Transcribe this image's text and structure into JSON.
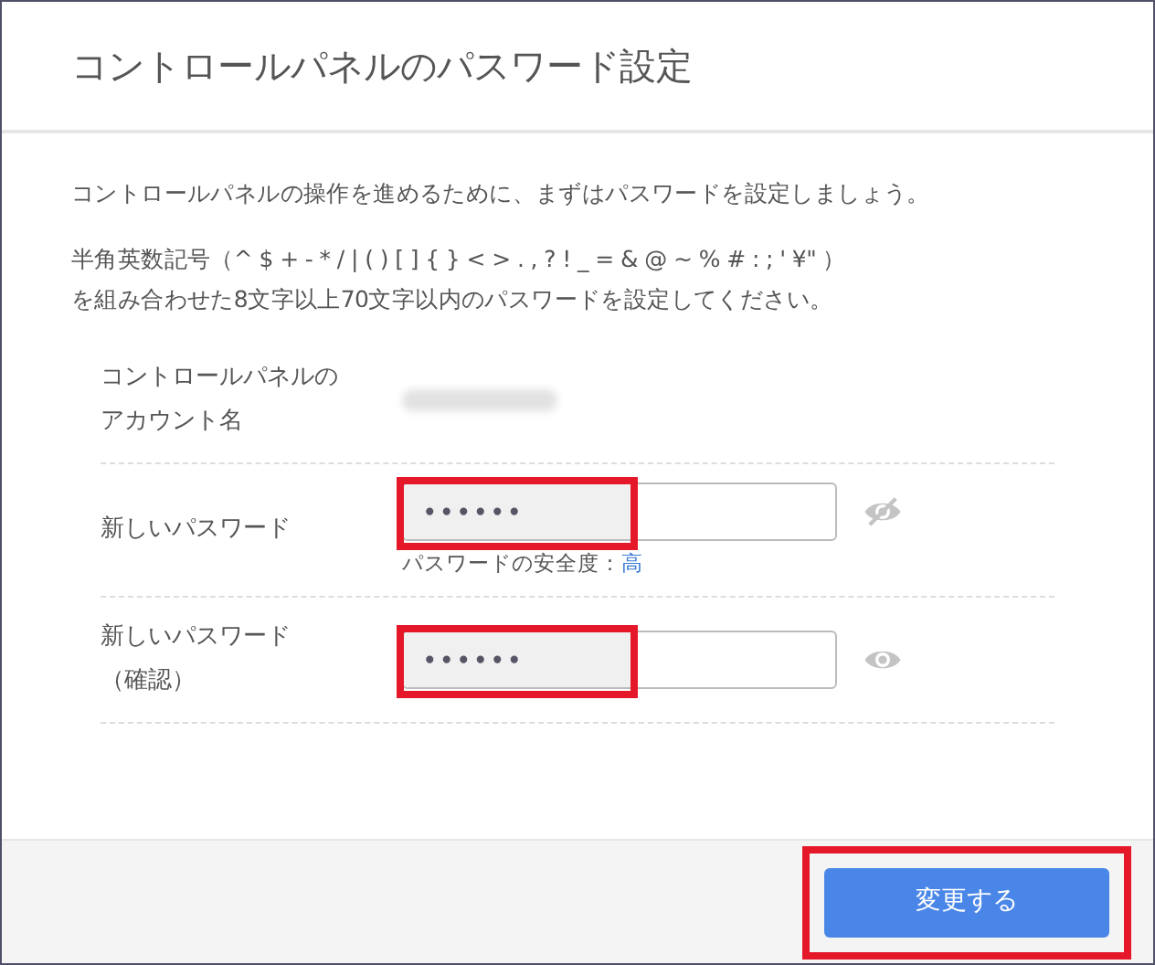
{
  "dialog": {
    "title": "コントロールパネルのパスワード設定"
  },
  "intro": "コントロールパネルの操作を進めるために、まずはパスワードを設定しましょう。",
  "rules": [
    "半角英数記号（^ $ + - * / | ( ) [ ] { } < > . , ? ! _ = & @ ~ % # : ; ' ¥\" ）",
    "を組み合わせた8文字以上70文字以内のパスワードを設定してください。"
  ],
  "account": {
    "label_lines": [
      "コントロールパネルの",
      "アカウント名"
    ],
    "redacted": true
  },
  "fields": [
    {
      "label_lines": [
        "新しいパスワード"
      ],
      "value": "••••••",
      "eye_crossed": true,
      "highlighted": true,
      "strength": {
        "label": "パスワードの安全度：",
        "value": "高"
      }
    },
    {
      "label_lines": [
        "新しいパスワード",
        "（確認）"
      ],
      "value": "••••••",
      "eye_crossed": false,
      "highlighted": true
    }
  ],
  "submit": {
    "label": "変更する",
    "highlighted": true
  }
}
